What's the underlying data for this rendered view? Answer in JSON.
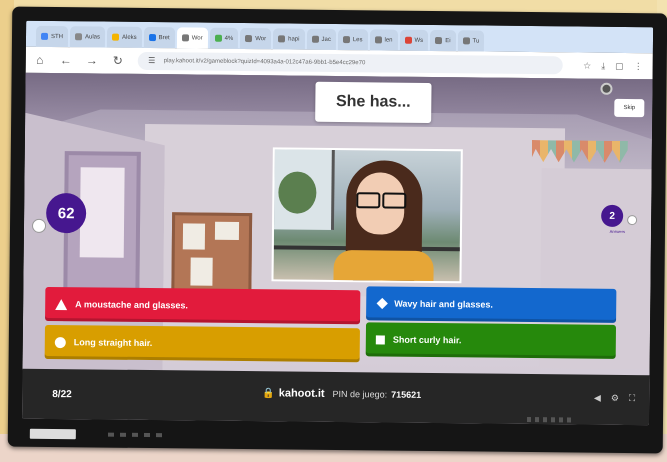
{
  "browser": {
    "tabs": [
      {
        "label": "STH",
        "color": "#4285f4",
        "active": false
      },
      {
        "label": "Aulas",
        "color": "#888888",
        "active": false
      },
      {
        "label": "Aleks",
        "color": "#f4b400",
        "active": false
      },
      {
        "label": "Bret",
        "color": "#1a73e8",
        "active": false
      },
      {
        "label": "Wor",
        "color": "#777777",
        "active": true
      },
      {
        "label": "4%",
        "color": "#4caf50",
        "active": false
      },
      {
        "label": "Wor",
        "color": "#777777",
        "active": false
      },
      {
        "label": "hapi",
        "color": "#777777",
        "active": false
      },
      {
        "label": "Jac",
        "color": "#777777",
        "active": false
      },
      {
        "label": "Les",
        "color": "#777777",
        "active": false
      },
      {
        "label": "len",
        "color": "#777777",
        "active": false
      },
      {
        "label": "Ws",
        "color": "#db4437",
        "active": false
      },
      {
        "label": "Ei",
        "color": "#777777",
        "active": false
      },
      {
        "label": "Tu",
        "color": "#777777",
        "active": false
      }
    ],
    "address": "play.kahoot.it/v2/gameblock?quizId=4093a4a-012c47a6-9bb1-b5e4cc29e70"
  },
  "game": {
    "question": "She has...",
    "skip_label": "Skip",
    "counter": "62",
    "answers_count": "2",
    "answers_label": "Answers",
    "answers": [
      {
        "text": "A moustache and glasses.",
        "shape": "triangle",
        "color": "#e21b3c"
      },
      {
        "text": "Wavy hair and glasses.",
        "shape": "diamond",
        "color": "#1368ce"
      },
      {
        "text": "Long straight hair.",
        "shape": "circle",
        "color": "#d89e00"
      },
      {
        "text": "Short curly hair.",
        "shape": "square",
        "color": "#26890c"
      }
    ],
    "footer": {
      "progress": "8/22",
      "site": "kahoot.it",
      "pin_label": "PIN de juego:",
      "pin": "715621"
    }
  }
}
